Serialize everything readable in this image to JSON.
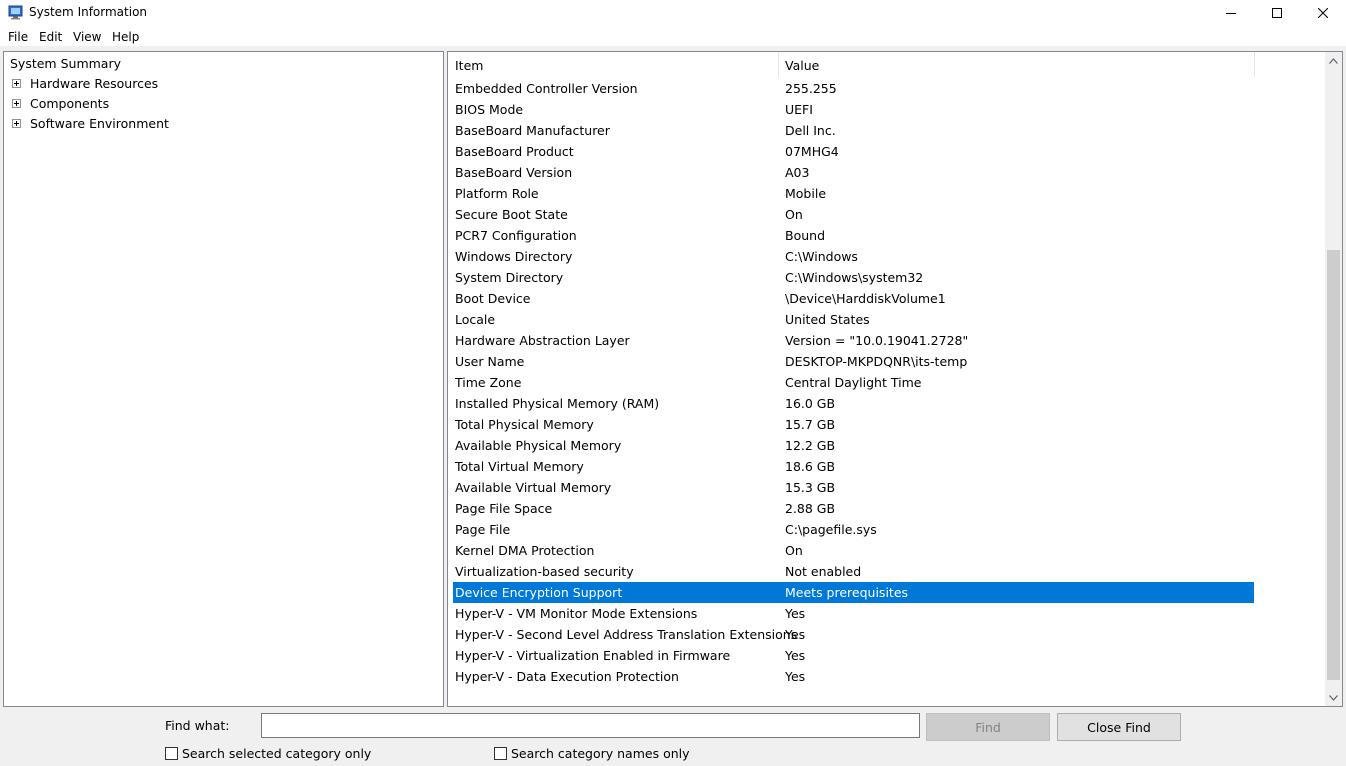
{
  "window": {
    "title": "System Information"
  },
  "menu": [
    "File",
    "Edit",
    "View",
    "Help"
  ],
  "tree": {
    "root": "System Summary",
    "nodes": [
      "Hardware Resources",
      "Components",
      "Software Environment"
    ]
  },
  "list": {
    "columns": {
      "item": "Item",
      "value": "Value"
    },
    "rows": [
      {
        "item": "Embedded Controller Version",
        "value": "255.255"
      },
      {
        "item": "BIOS Mode",
        "value": "UEFI"
      },
      {
        "item": "BaseBoard Manufacturer",
        "value": "Dell Inc."
      },
      {
        "item": "BaseBoard Product",
        "value": "07MHG4"
      },
      {
        "item": "BaseBoard Version",
        "value": "A03"
      },
      {
        "item": "Platform Role",
        "value": "Mobile"
      },
      {
        "item": "Secure Boot State",
        "value": "On"
      },
      {
        "item": "PCR7 Configuration",
        "value": "Bound"
      },
      {
        "item": "Windows Directory",
        "value": "C:\\Windows"
      },
      {
        "item": "System Directory",
        "value": "C:\\Windows\\system32"
      },
      {
        "item": "Boot Device",
        "value": "\\Device\\HarddiskVolume1"
      },
      {
        "item": "Locale",
        "value": "United States"
      },
      {
        "item": "Hardware Abstraction Layer",
        "value": "Version = \"10.0.19041.2728\""
      },
      {
        "item": "User Name",
        "value": "DESKTOP-MKPDQNR\\its-temp"
      },
      {
        "item": "Time Zone",
        "value": "Central Daylight Time"
      },
      {
        "item": "Installed Physical Memory (RAM)",
        "value": "16.0 GB"
      },
      {
        "item": "Total Physical Memory",
        "value": "15.7 GB"
      },
      {
        "item": "Available Physical Memory",
        "value": "12.2 GB"
      },
      {
        "item": "Total Virtual Memory",
        "value": "18.6 GB"
      },
      {
        "item": "Available Virtual Memory",
        "value": "15.3 GB"
      },
      {
        "item": "Page File Space",
        "value": "2.88 GB"
      },
      {
        "item": "Page File",
        "value": "C:\\pagefile.sys"
      },
      {
        "item": "Kernel DMA Protection",
        "value": "On"
      },
      {
        "item": "Virtualization-based security",
        "value": "Not enabled"
      },
      {
        "item": "Device Encryption Support",
        "value": "Meets prerequisites",
        "selected": true
      },
      {
        "item": "Hyper-V - VM Monitor Mode Extensions",
        "value": "Yes"
      },
      {
        "item": "Hyper-V - Second Level Address Translation Extensions",
        "value": "Yes"
      },
      {
        "item": "Hyper-V - Virtualization Enabled in Firmware",
        "value": "Yes"
      },
      {
        "item": "Hyper-V - Data Execution Protection",
        "value": "Yes"
      }
    ]
  },
  "find": {
    "label": "Find what:",
    "value": "",
    "find_button": "Find",
    "close_button": "Close Find",
    "opt_selected_category": "Search selected category only",
    "opt_category_names": "Search category names only"
  },
  "colors": {
    "selection": "#0078d7"
  },
  "icons": [
    "system-info-app-icon",
    "minimize-icon",
    "maximize-icon",
    "close-icon",
    "expand-plus-icon",
    "scroll-up-arrow-icon",
    "scroll-down-arrow-icon"
  ]
}
